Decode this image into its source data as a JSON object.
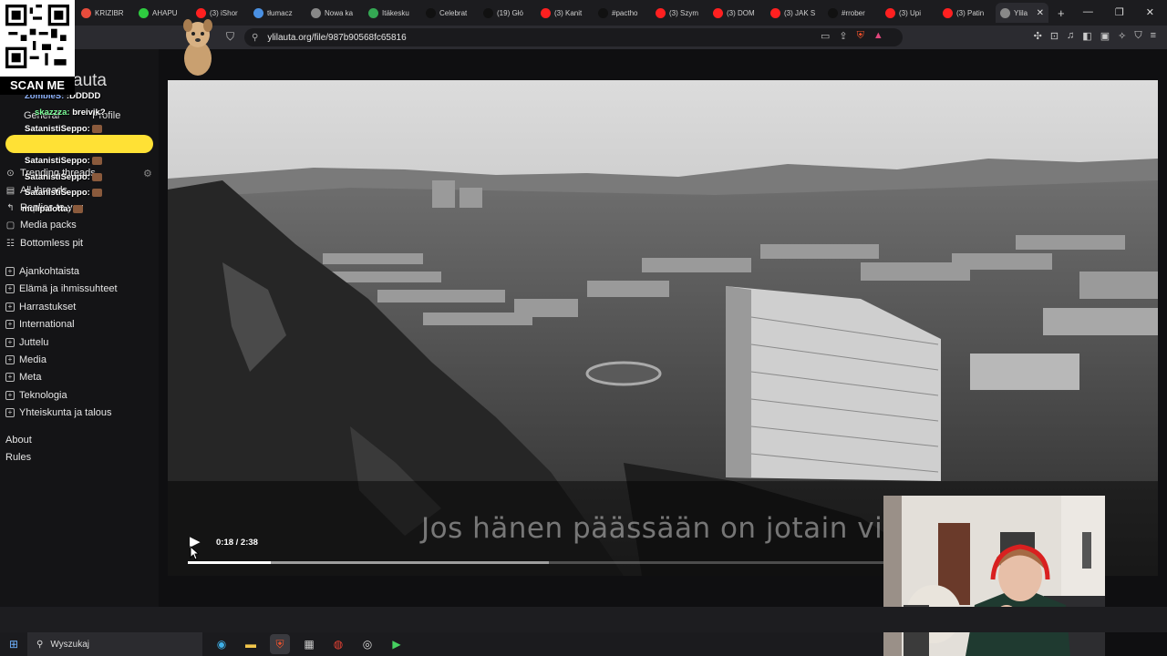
{
  "browser": {
    "tabs": [
      {
        "label": "KRIZIBR",
        "color": "#e74c3c"
      },
      {
        "label": "AHAPU",
        "color": "#2ecc40"
      },
      {
        "label": "(3) iShor",
        "color": "#ff2020"
      },
      {
        "label": "tłumacz",
        "color": "#4a90e2"
      },
      {
        "label": "Nowa ka",
        "color": "#888888"
      },
      {
        "label": "Itäkesku",
        "color": "#34a853"
      },
      {
        "label": "Celebrat",
        "color": "#111111"
      },
      {
        "label": "(19) Głó",
        "color": "#111111"
      },
      {
        "label": "(3) Kanit",
        "color": "#ff2020"
      },
      {
        "label": "#pactho",
        "color": "#111111"
      },
      {
        "label": "(3) Szym",
        "color": "#ff2020"
      },
      {
        "label": "(3) DOM",
        "color": "#ff2020"
      },
      {
        "label": "(3) JAK S",
        "color": "#ff2020"
      },
      {
        "label": "#rrober",
        "color": "#111111"
      },
      {
        "label": "(3) Upi",
        "color": "#ff2020"
      },
      {
        "label": "(3) Patin",
        "color": "#ff2020"
      }
    ],
    "active_tab": {
      "label": "Ylila",
      "close": "✕"
    },
    "new_tab": "+",
    "url": "ylilauta.org/file/987b90568fc65816"
  },
  "overlay": {
    "qr_label": "SCAN ME",
    "chat": [
      {
        "user": "ZombieS:",
        "msg": ":DDDDD",
        "user_class": "u1"
      },
      {
        "user": "skazzza:",
        "msg": "breivik?",
        "user_class": "u2"
      },
      {
        "user": "SatanistiSeppo:",
        "msg": "",
        "user_class": "",
        "emote": true
      },
      {
        "user": "SatanistiSeppo:",
        "msg": "",
        "user_class": "",
        "emote": true
      },
      {
        "user": "SatanistiSeppo:",
        "msg": "",
        "user_class": "",
        "emote": true
      },
      {
        "user": "SatanistiSeppo:",
        "msg": "",
        "user_class": "",
        "emote": true
      },
      {
        "user": "mulipalotta:",
        "msg": "",
        "user_class": "",
        "emote": true
      }
    ]
  },
  "site": {
    "logo_text": "auta",
    "nav_tabs": [
      "General",
      "Profile"
    ],
    "top_links": [
      {
        "label": "Trending threads",
        "icon": "⚙"
      },
      {
        "label": "All threads",
        "icon": "▤"
      },
      {
        "label": "Replies to you",
        "icon": "↰"
      },
      {
        "label": "Media packs",
        "icon": "▢"
      },
      {
        "label": "Bottomless pit",
        "icon": "☷"
      }
    ],
    "boards": [
      "Ajankohtaista",
      "Elämä ja ihmissuhteet",
      "Harrastukset",
      "International",
      "Juttelu",
      "Media",
      "Meta",
      "Teknologia",
      "Yhteiskunta ja talous"
    ],
    "footer_links": [
      "About",
      "Rules"
    ]
  },
  "video": {
    "subtitle": "Jos hänen päässään on jotain via",
    "time": "0:18 / 2:38",
    "progress": 0.1149,
    "buffered": 0.5
  },
  "taskbar": {
    "search_placeholder": "Wyszukaj"
  }
}
